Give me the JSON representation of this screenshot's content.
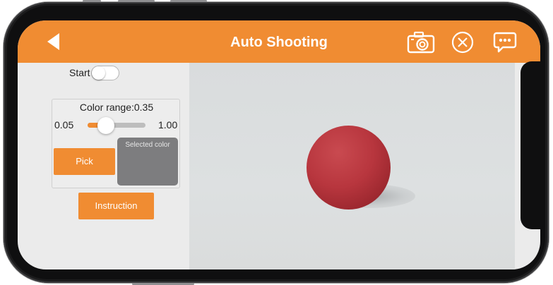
{
  "header": {
    "title": "Auto Shooting",
    "back_icon": "back-arrow-icon",
    "icons": [
      "camera-icon",
      "close-circle-icon",
      "chat-icon"
    ]
  },
  "controls": {
    "start_label": "Start",
    "start_enabled": false,
    "color_range_label": "Color range:0.35",
    "range_min": "0.05",
    "range_max": "1.00",
    "range_value": 0.35,
    "pick_label": "Pick",
    "selected_color_label": "Selected color",
    "selected_color": "#7d7d7f",
    "instruction_label": "Instruction"
  },
  "camera": {
    "subject": "red ball",
    "ball_color": "#b8363e"
  },
  "colors": {
    "accent": "#f08c32",
    "panel_bg": "#ebebeb"
  }
}
